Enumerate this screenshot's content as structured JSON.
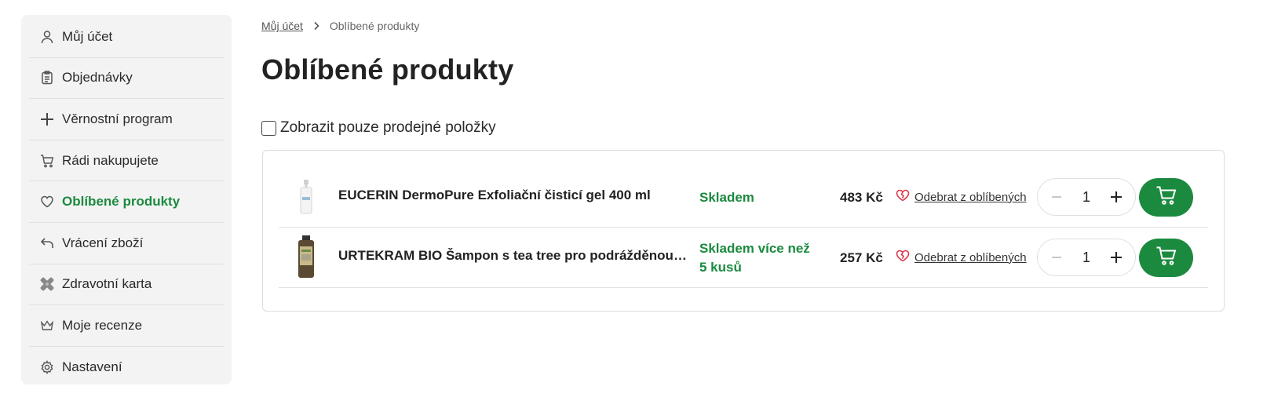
{
  "sidebar": {
    "items": [
      {
        "label": "Můj účet",
        "icon": "user-icon"
      },
      {
        "label": "Objednávky",
        "icon": "clipboard-icon"
      },
      {
        "label": "Věrnostní program",
        "icon": "plus-icon"
      },
      {
        "label": "Rádi nakupujete",
        "icon": "cart-icon"
      },
      {
        "label": "Oblíbené produkty",
        "icon": "heart-icon",
        "active": true
      },
      {
        "label": "Vrácení zboží",
        "icon": "return-icon"
      },
      {
        "label": "Zdravotní karta",
        "icon": "bandage-icon"
      },
      {
        "label": "Moje recenze",
        "icon": "crown-icon"
      },
      {
        "label": "Nastavení",
        "icon": "gear-icon"
      }
    ]
  },
  "breadcrumb": {
    "home": "Můj účet",
    "current": "Oblíbené produkty"
  },
  "page": {
    "title": "Oblíbené produkty"
  },
  "filter": {
    "label": "Zobrazit pouze prodejné položky",
    "checked": false
  },
  "products": [
    {
      "name": "EUCERIN DermoPure Exfoliační čisticí gel 400 ml",
      "stock": "Skladem",
      "price": "483 Kč",
      "remove_label": "Odebrat z oblíbených",
      "quantity": "1"
    },
    {
      "name": "URTEKRAM BIO Šampon s tea tree pro podrážděnou vlasovou pokožku",
      "stock": "Skladem více než 5 kusů",
      "price": "257 Kč",
      "remove_label": "Odebrat z oblíbených",
      "quantity": "1"
    }
  ],
  "colors": {
    "accent": "#1b8a3f",
    "remove_heart": "#d93a4a"
  }
}
